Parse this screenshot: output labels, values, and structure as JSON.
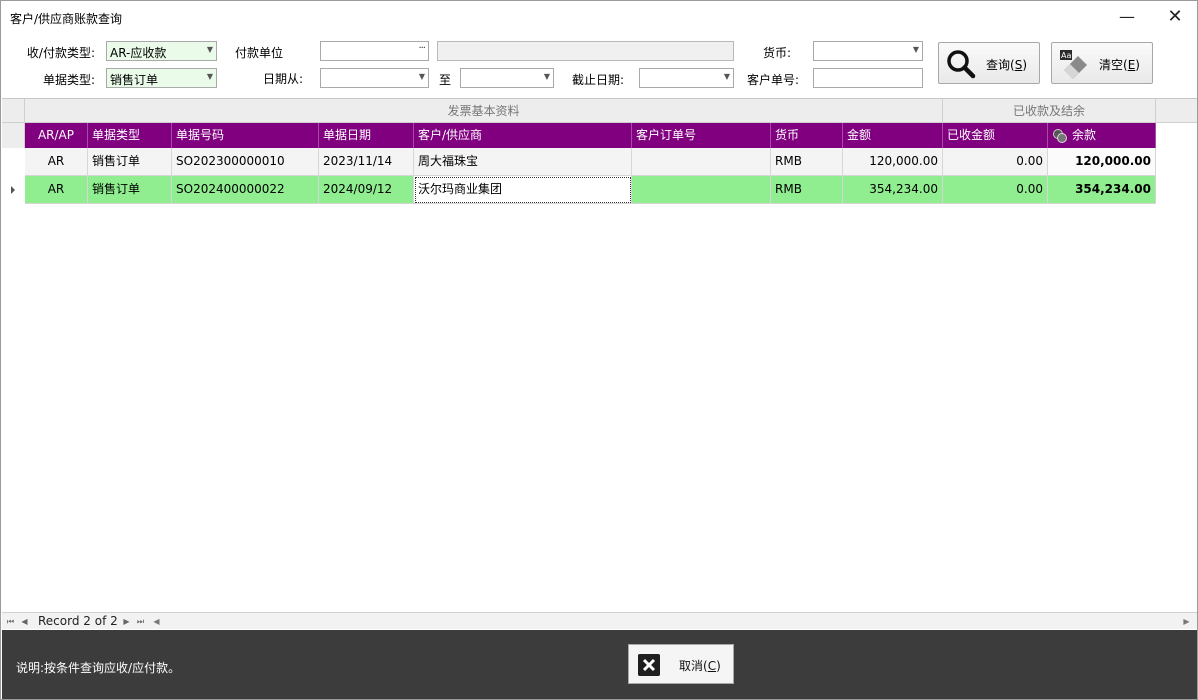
{
  "window": {
    "title": "客户/供应商账款查询",
    "minimize_glyph": "—",
    "close_glyph": "✕"
  },
  "filters": {
    "type_label": "收/付款类型:",
    "type_value": "AR-应收款",
    "doc_type_label": "单据类型:",
    "doc_type_value": "销售订单",
    "payer_label": "付款单位",
    "payer_value": "",
    "payer_button": "···",
    "date_from_label": "日期从:",
    "date_to_label": "至",
    "cutoff_label": "截止日期:",
    "currency_label": "货币:",
    "customer_no_label": "客户单号:"
  },
  "buttons": {
    "query_label": "查询(",
    "query_key": "S",
    "query_end": ")",
    "clear_label": "清空(",
    "clear_key": "E",
    "clear_end": ")",
    "clear_icon_text": "Aa",
    "cancel_label": "取消(",
    "cancel_key": "C",
    "cancel_end": ")"
  },
  "grid": {
    "bands": [
      "发票基本资料",
      "已收款及结余"
    ],
    "columns": [
      "AR/AP",
      "单据类型",
      "单据号码",
      "单据日期",
      "客户/供应商",
      "客户订单号",
      "货币",
      "金额",
      "已收金额",
      "余款"
    ],
    "rows": [
      [
        "AR",
        "销售订单",
        "SO202300000010",
        "2023/11/14",
        "周大福珠宝",
        "",
        "RMB",
        "120,000.00",
        "0.00",
        "120,000.00"
      ],
      [
        "AR",
        "销售订单",
        "SO202400000022",
        "2024/09/12",
        "沃尔玛商业集团",
        "",
        "RMB",
        "354,234.00",
        "0.00",
        "354,234.00"
      ]
    ],
    "selected_row_color": "#90ee90",
    "header_color": "#800080"
  },
  "navigator": {
    "record_text": "Record 2 of 2"
  },
  "footer": {
    "description": "说明:按条件查询应收/应付款。"
  }
}
